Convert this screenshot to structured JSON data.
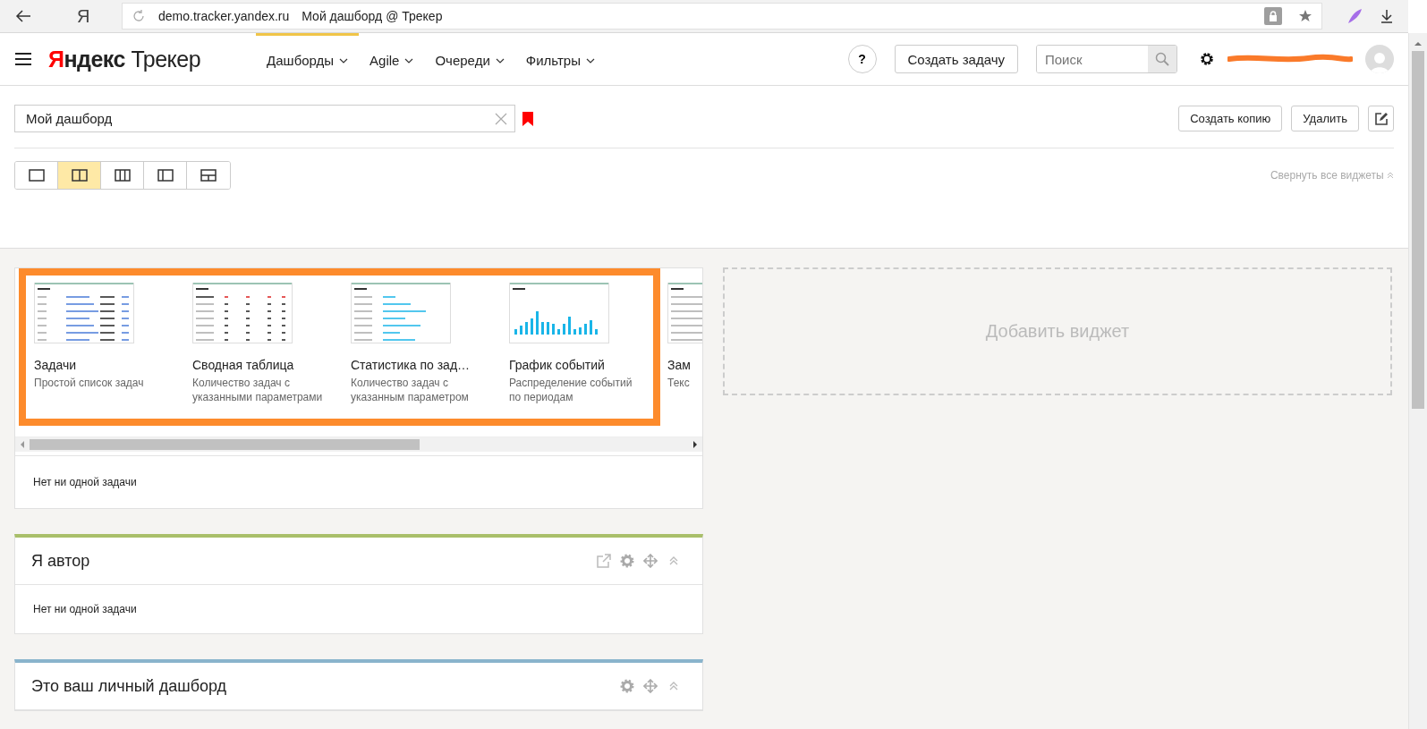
{
  "browser": {
    "logo": "Я",
    "url": "demo.tracker.yandex.ru",
    "page_title": "Мой дашборд @ Трекер"
  },
  "header": {
    "logo": {
      "brand": "Яндекс",
      "product": "Трекер"
    },
    "nav": [
      {
        "label": "Дашборды",
        "selected": true
      },
      {
        "label": "Agile",
        "selected": false
      },
      {
        "label": "Очереди",
        "selected": false
      },
      {
        "label": "Фильтры",
        "selected": false
      }
    ],
    "help": "?",
    "create_button": "Создать задачу",
    "search": {
      "placeholder": "Поиск"
    }
  },
  "dashboard": {
    "title": "Мой дашборд",
    "actions": [
      "Создать копию",
      "Удалить"
    ],
    "layouts": [
      {
        "kind": "one",
        "selected": false
      },
      {
        "kind": "two",
        "selected": true
      },
      {
        "kind": "three",
        "selected": false
      },
      {
        "kind": "side",
        "selected": false
      },
      {
        "kind": "grid",
        "selected": false
      }
    ],
    "collapse_all": "Свернуть все виджеты"
  },
  "catalog": {
    "items": [
      {
        "kind": "list",
        "title": "Задачи",
        "description": "Простой список задач"
      },
      {
        "kind": "table",
        "title": "Сводная таблица",
        "description": "Количество задач с указанными параметрами"
      },
      {
        "kind": "stats",
        "title": "Статистика по зад…",
        "description": "Количество задач с указанным параметром"
      },
      {
        "kind": "chart",
        "title": "График событий",
        "description": "Распределение событий по периодам"
      },
      {
        "kind": "text",
        "title": "Зам",
        "description": "Текс"
      }
    ],
    "empty": "Нет ни одной задачи"
  },
  "widgets": [
    {
      "title": "Я автор",
      "color": "#a9bf6a",
      "actions": [
        {
          "kind": "open"
        },
        {
          "kind": "settings"
        },
        {
          "kind": "move"
        },
        {
          "kind": "collapse"
        }
      ],
      "empty": "Нет ни одной задачи"
    },
    {
      "title": "Это ваш личный дашборд",
      "color": "#89b4cc",
      "actions": [
        {
          "kind": "settings"
        },
        {
          "kind": "move"
        },
        {
          "kind": "collapse"
        }
      ]
    }
  ],
  "add_widget": "Добавить виджет"
}
